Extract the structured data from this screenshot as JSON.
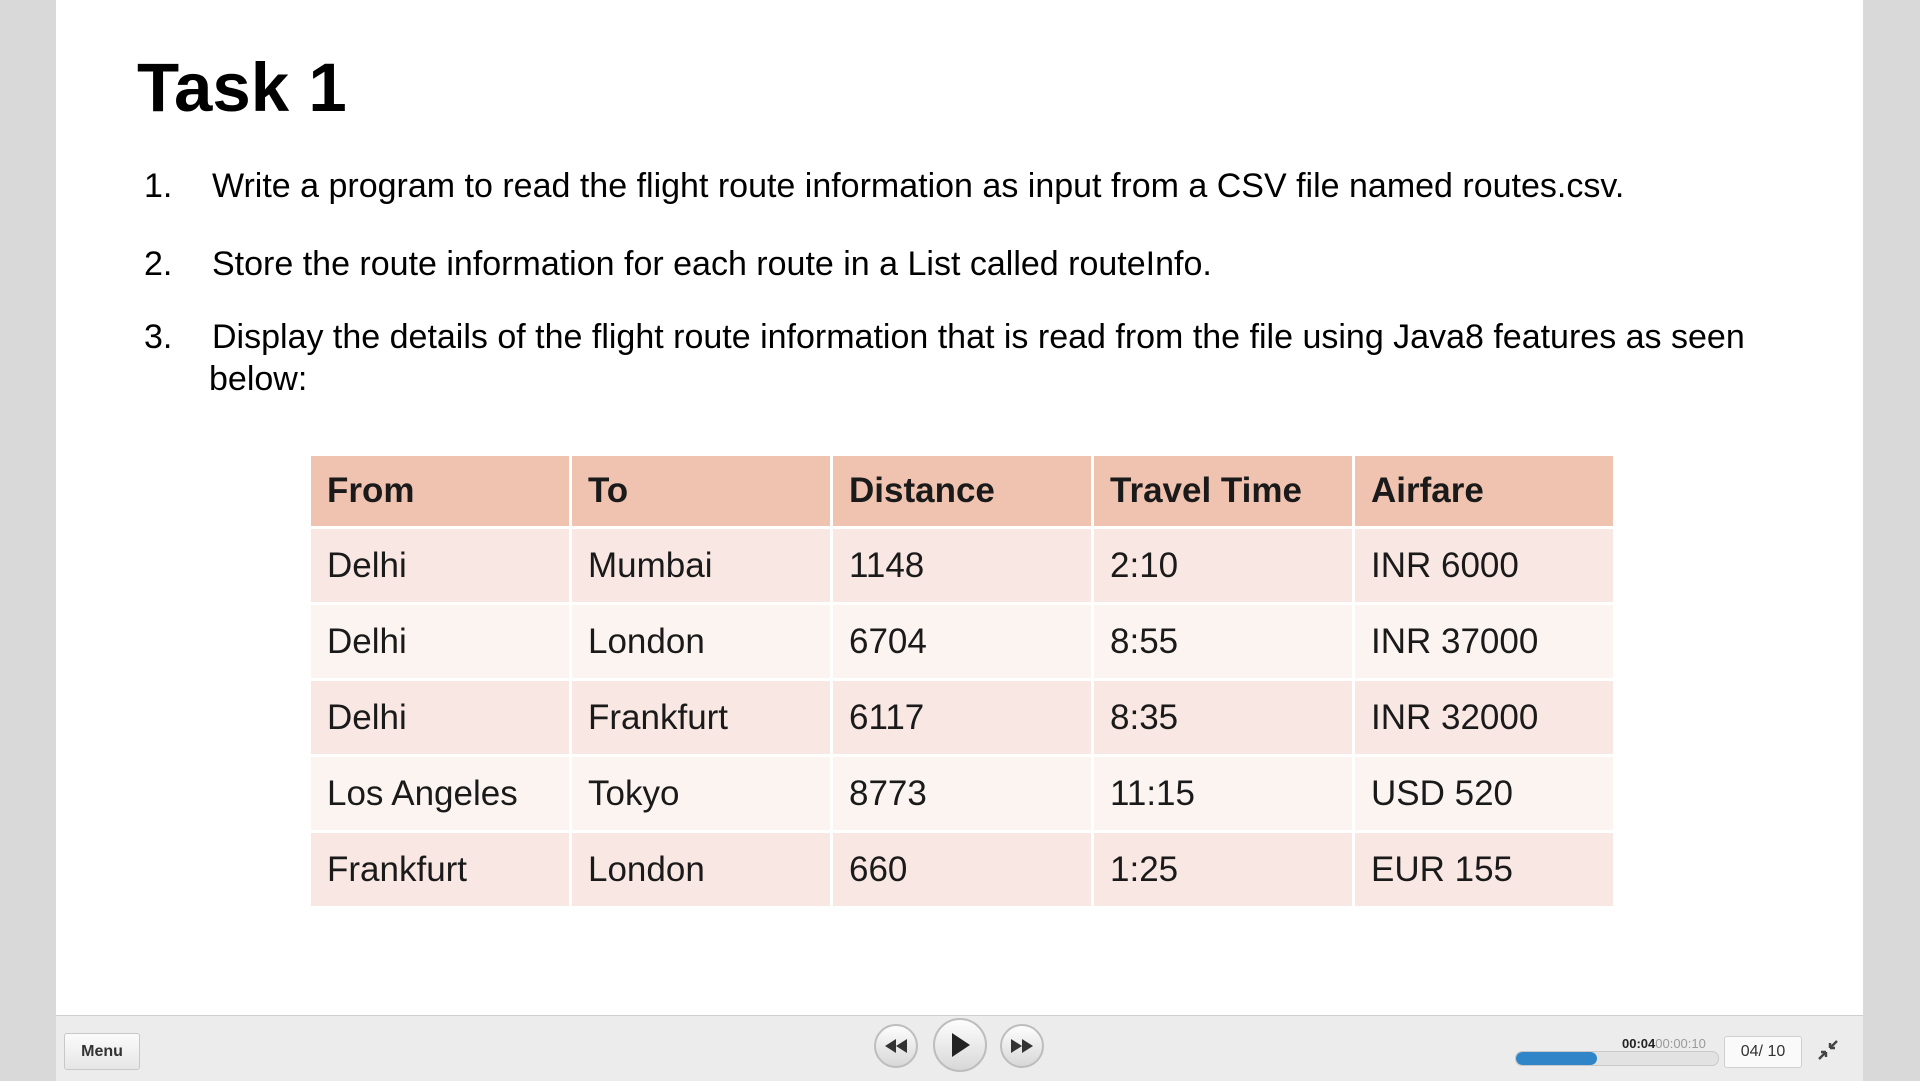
{
  "slide": {
    "title": "Task 1",
    "items": [
      {
        "num": "1.",
        "text": "Write a program to read the flight route information as input from a CSV file named routes.csv."
      },
      {
        "num": "2.",
        "text": "Store the route information for each route in a List called routeInfo."
      },
      {
        "num": "3.",
        "text": "Display the details of the flight route information that is read from the file using Java8 features as seen below:"
      }
    ],
    "table": {
      "headers": [
        "From",
        "To",
        "Distance",
        "Travel Time",
        "Airfare"
      ],
      "rows": [
        [
          "Delhi",
          "Mumbai",
          "1148",
          "2:10",
          "INR 6000"
        ],
        [
          "Delhi",
          "London",
          "6704",
          "8:55",
          "INR 37000"
        ],
        [
          "Delhi",
          "Frankfurt",
          "6117",
          "8:35",
          "INR 32000"
        ],
        [
          "Los Angeles",
          "Tokyo",
          "8773",
          "11:15",
          "USD 520"
        ],
        [
          "Frankfurt",
          "London",
          "660",
          "1:25",
          "EUR 155"
        ]
      ]
    }
  },
  "player": {
    "menu_label": "Menu",
    "time_current": "00:04",
    "time_total": "00:00:10",
    "page": "04/ 10",
    "progress": 0.4,
    "accent": "#2f85c8",
    "icons": [
      "rewind-icon",
      "play-icon",
      "fast-forward-icon",
      "collapse-icon"
    ]
  }
}
